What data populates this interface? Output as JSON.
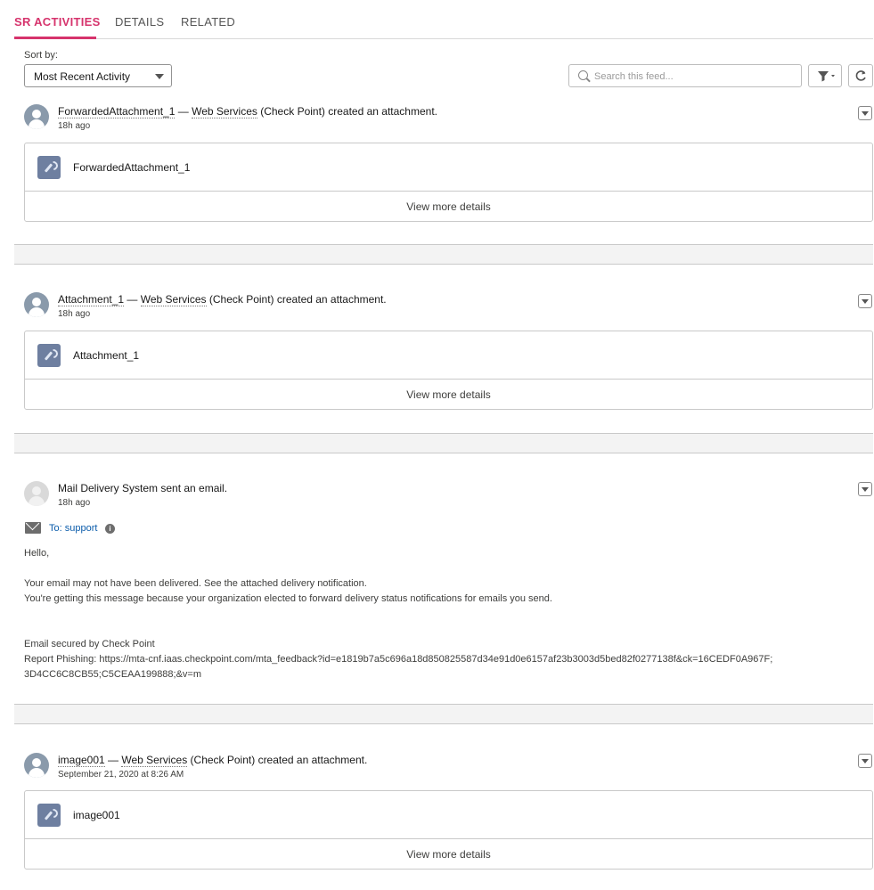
{
  "tabs": [
    {
      "label": "SR ACTIVITIES",
      "active": true
    },
    {
      "label": "DETAILS",
      "active": false
    },
    {
      "label": "RELATED",
      "active": false
    }
  ],
  "toolbar": {
    "sort_label": "Sort by:",
    "sort_value": "Most Recent Activity",
    "search_placeholder": "Search this feed...",
    "filter_icon": "filter-icon",
    "refresh_icon": "refresh-icon"
  },
  "feed": [
    {
      "actor": "ForwardedAttachment_1",
      "sep": " — ",
      "by": "Web Services",
      "rest": " (Check Point) created an attachment.",
      "time": "18h ago",
      "file": "ForwardedAttachment_1",
      "more": "View more details"
    },
    {
      "actor": "Attachment_1",
      "sep": " — ",
      "by": "Web Services",
      "rest": " (Check Point) created an attachment.",
      "time": "18h ago",
      "file": "Attachment_1",
      "more": "View more details"
    },
    {
      "headline": "Mail Delivery System sent an email.",
      "time": "18h ago",
      "to": "To: support",
      "body": [
        "Hello,",
        "Your email may not have been delivered. See the attached delivery notification.",
        "You're getting this message because your organization elected to forward delivery status notifications for emails you send.",
        "Email secured by Check Point",
        "Report Phishing: https://mta-cnf.iaas.checkpoint.com/mta_feedback?id=e1819b7a5c696a18d850825587d34e91d0e6157af23b3003d5bed82f0277138f&ck=16CEDF0A967F;",
        "3D4CC6C8CB55;C5CEAA199888;&v=m"
      ]
    },
    {
      "actor": "image001",
      "sep": " — ",
      "by": "Web Services",
      "rest": " (Check Point) created an attachment.",
      "time": "September 21, 2020 at 8:26 AM",
      "file": "image001",
      "more": "View more details"
    }
  ]
}
